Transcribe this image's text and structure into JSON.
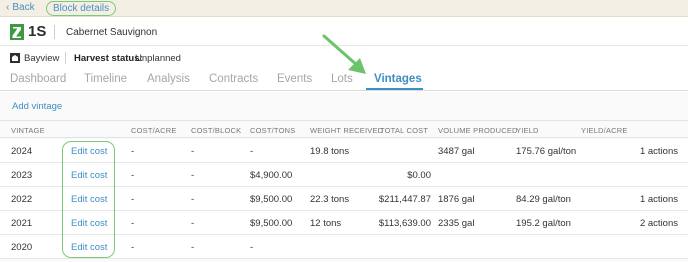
{
  "breadcrumb": {
    "back_label": "Back",
    "current": "Block details"
  },
  "block": {
    "code": "1S",
    "variety": "Cabernet Sauvignon"
  },
  "meta": {
    "farm": "Bayview",
    "harvest_label": "Harvest status:",
    "harvest_value": "Unplanned"
  },
  "tabs": [
    {
      "label": "Dashboard"
    },
    {
      "label": "Timeline"
    },
    {
      "label": "Analysis"
    },
    {
      "label": "Contracts"
    },
    {
      "label": "Events"
    },
    {
      "label": "Lots"
    },
    {
      "label": "Vintages"
    }
  ],
  "active_tab": "Vintages",
  "add_vintage_label": "Add vintage",
  "table": {
    "columns": [
      "VINTAGE",
      "COST/ACRE",
      "COST/BLOCK",
      "COST/TONS",
      "WEIGHT RECEIVED",
      "TOTAL COST",
      "VOLUME PRODUCED",
      "YIELD",
      "YIELD/ACRE"
    ],
    "rows": [
      {
        "vintage": "2024",
        "edit": "Edit cost",
        "cost_acre": "-",
        "cost_block": "-",
        "cost_tons": "-",
        "weight": "19.8 tons",
        "total_cost": "",
        "volume": "3487 gal",
        "yield": "175.76 gal/ton",
        "yield_acre": "",
        "actions": "1 actions"
      },
      {
        "vintage": "2023",
        "edit": "Edit cost",
        "cost_acre": "-",
        "cost_block": "-",
        "cost_tons": "$4,900.00",
        "weight": "",
        "total_cost": "$0.00",
        "volume": "",
        "yield": "",
        "yield_acre": "",
        "actions": ""
      },
      {
        "vintage": "2022",
        "edit": "Edit cost",
        "cost_acre": "-",
        "cost_block": "-",
        "cost_tons": "$9,500.00",
        "weight": "22.3 tons",
        "total_cost": "$211,447.87",
        "volume": "1876 gal",
        "yield": "84.29 gal/ton",
        "yield_acre": "",
        "actions": "1 actions"
      },
      {
        "vintage": "2021",
        "edit": "Edit cost",
        "cost_acre": "-",
        "cost_block": "-",
        "cost_tons": "$9,500.00",
        "weight": "12 tons",
        "total_cost": "$113,639.00",
        "volume": "2335 gal",
        "yield": "195.2 gal/ton",
        "yield_acre": "",
        "actions": "2 actions"
      },
      {
        "vintage": "2020",
        "edit": "Edit cost",
        "cost_acre": "-",
        "cost_block": "-",
        "cost_tons": "-",
        "weight": "",
        "total_cost": "",
        "volume": "",
        "yield": "",
        "yield_acre": "",
        "actions": ""
      }
    ]
  },
  "colors": {
    "accent": "#3d8fc2",
    "annotation": "#7cc97a",
    "brand_green": "#3a9a3f"
  }
}
